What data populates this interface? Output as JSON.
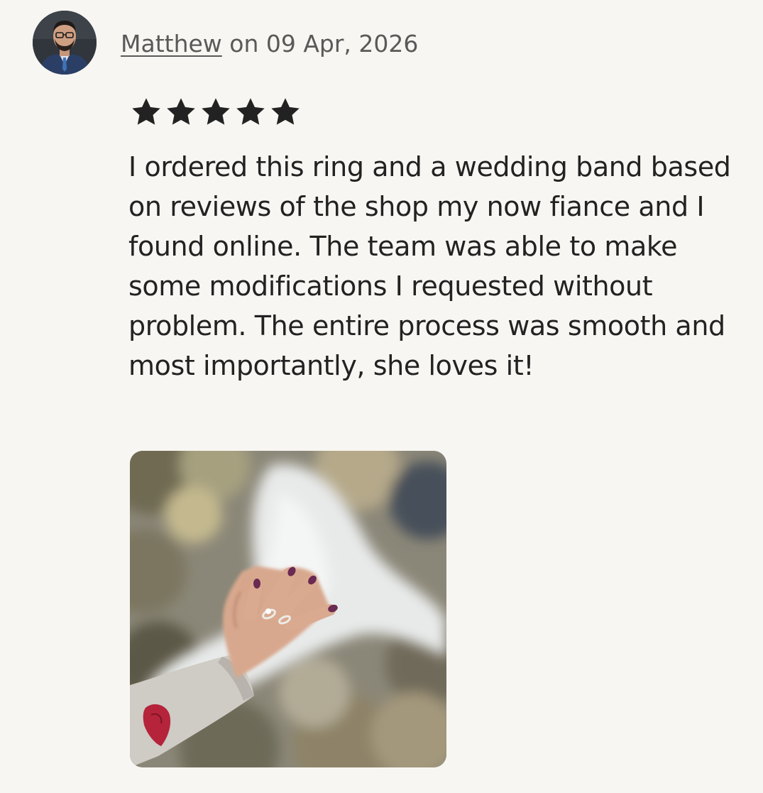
{
  "reviewer": {
    "name": "Matthew",
    "date_text": " on 09 Apr, 2026",
    "avatar_icon": "user-avatar-photo"
  },
  "rating": {
    "value": 5,
    "max": 5,
    "star_icon": "star-icon",
    "star_color": "#222222"
  },
  "review": {
    "text": "I ordered this ring and a wedding band based on reviews of the shop my now fiance and I found online. The team was able to make some modifications I requested without problem. The entire process was smooth and most importantly, she loves it!"
  },
  "photo": {
    "icon": "review-photo-hand-with-ring"
  },
  "colors": {
    "background": "#f7f6f2",
    "muted_text": "#595959",
    "body_text": "#222222"
  }
}
